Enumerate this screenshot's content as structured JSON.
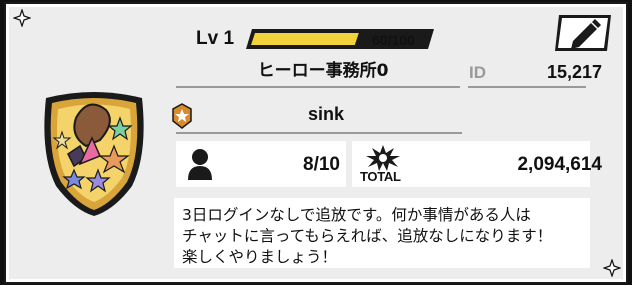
{
  "level": {
    "label": "Lv 1",
    "current": 60,
    "max": 100,
    "text": "60/100",
    "fill_fraction": 0.6
  },
  "agency": {
    "name": "ヒーロー事務所0"
  },
  "id": {
    "label": "ID",
    "value": "15,217"
  },
  "leader": {
    "name": "sink"
  },
  "members": {
    "value": "8/10"
  },
  "total": {
    "label": "TOTAL",
    "value": "2,094,614"
  },
  "description": "3日ログインなしで追放です。何か事情がある人は\nチャットに言ってもらえれば、追放なしになります！\n楽しくやりましょう！",
  "colors": {
    "exp_fill": "#f2d33a",
    "card_bg": "#ededed",
    "emblem_gold": "#d9a43a"
  },
  "icons": [
    "edit-pencil-icon",
    "crest-emblem-icon",
    "rank-medal-icon",
    "member-silhouette-icon",
    "total-burst-icon",
    "corner-star-icon"
  ]
}
